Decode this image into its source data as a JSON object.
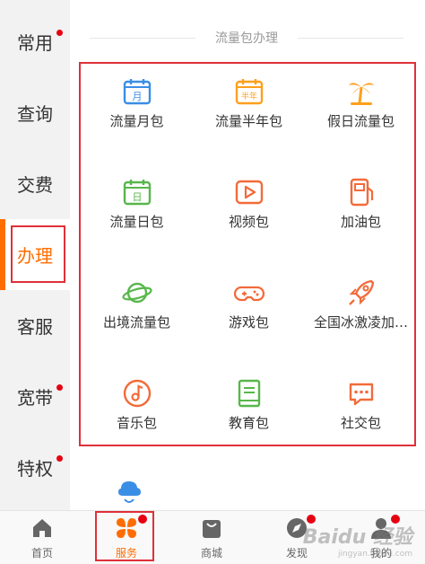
{
  "colors": {
    "accent": "#ff6d00",
    "highlight": "#e0303a",
    "badge": "#e60012",
    "blue": "#3a8ee6",
    "green": "#58b74b"
  },
  "sidebar": {
    "items": [
      {
        "label": "常用",
        "dot": true
      },
      {
        "label": "查询",
        "dot": false
      },
      {
        "label": "交费",
        "dot": false
      },
      {
        "label": "办理",
        "dot": false,
        "active": true
      },
      {
        "label": "客服",
        "dot": false
      },
      {
        "label": "宽带",
        "dot": true
      },
      {
        "label": "特权",
        "dot": true
      }
    ]
  },
  "section": {
    "title": "流量包办理"
  },
  "tiles": [
    {
      "label": "流量月包",
      "icon": "calendar-month-icon"
    },
    {
      "label": "流量半年包",
      "icon": "calendar-half-year-icon"
    },
    {
      "label": "假日流量包",
      "icon": "palm-tree-icon"
    },
    {
      "label": "流量日包",
      "icon": "calendar-day-icon"
    },
    {
      "label": "视频包",
      "icon": "video-play-icon"
    },
    {
      "label": "加油包",
      "icon": "fuel-pump-icon"
    },
    {
      "label": "出境流量包",
      "icon": "planet-icon"
    },
    {
      "label": "游戏包",
      "icon": "gamepad-icon"
    },
    {
      "label": "全国冰激凌加…",
      "icon": "rocket-icon"
    },
    {
      "label": "音乐包",
      "icon": "music-disc-icon"
    },
    {
      "label": "教育包",
      "icon": "book-icon"
    },
    {
      "label": "社交包",
      "icon": "chat-bubble-icon"
    }
  ],
  "icon_text": {
    "month": "月",
    "half_year": "半年",
    "day": "日"
  },
  "tabbar": {
    "tabs": [
      {
        "label": "首页",
        "icon": "home-icon"
      },
      {
        "label": "服务",
        "icon": "service-icon",
        "active": true,
        "dot": true
      },
      {
        "label": "商城",
        "icon": "shopping-bag-icon"
      },
      {
        "label": "发现",
        "icon": "compass-icon",
        "dot": true
      },
      {
        "label": "我的",
        "icon": "user-icon",
        "dot": true
      }
    ]
  },
  "watermark": {
    "brand": "Baidu 经验",
    "url": "jingyan.baidu.com"
  }
}
